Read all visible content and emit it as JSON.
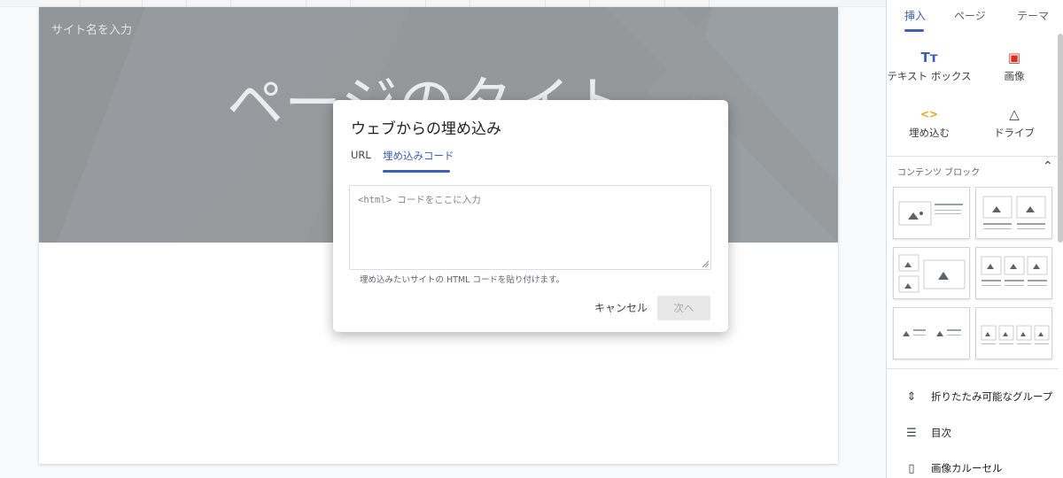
{
  "editor": {
    "site_name": "サイト名を入力",
    "page_title": "ページのタイト"
  },
  "panel": {
    "tabs": [
      "挿入",
      "ページ",
      "テーマ"
    ],
    "active_tab": "挿入",
    "insert_tools": [
      {
        "icon": "text-box-icon",
        "glyph": "Tт",
        "label": "テキスト ボックス"
      },
      {
        "icon": "image-icon",
        "glyph": "▣",
        "label": "画像"
      },
      {
        "icon": "embed-code-icon",
        "glyph": "<>",
        "label": "埋め込む"
      },
      {
        "icon": "drive-icon",
        "glyph": "△",
        "label": "ドライブ"
      }
    ],
    "content_blocks_title": "コンテンツ ブロック",
    "list_items": [
      {
        "icon": "collapsible-group-icon",
        "glyph": "⇕",
        "label": "折りたたみ可能なグループ"
      },
      {
        "icon": "table-of-contents-icon",
        "glyph": "☰",
        "label": "目次"
      },
      {
        "icon": "image-carousel-icon",
        "glyph": "▯",
        "label": "画像カルーセル"
      }
    ]
  },
  "dialog": {
    "title": "ウェブからの埋め込み",
    "tabs": [
      "URL",
      "埋め込みコード"
    ],
    "active_tab": "埋め込みコード",
    "code_placeholder": "<html> コードをここに入力",
    "hint": "埋め込みたいサイトの HTML コードを貼り付けます。",
    "cancel_label": "キャンセル",
    "next_label": "次へ"
  },
  "colors": {
    "accent": "#3c5fb8",
    "hero_bg": "#2c343b",
    "embed_icon": "#e8a418",
    "image_icon": "#d93025"
  }
}
